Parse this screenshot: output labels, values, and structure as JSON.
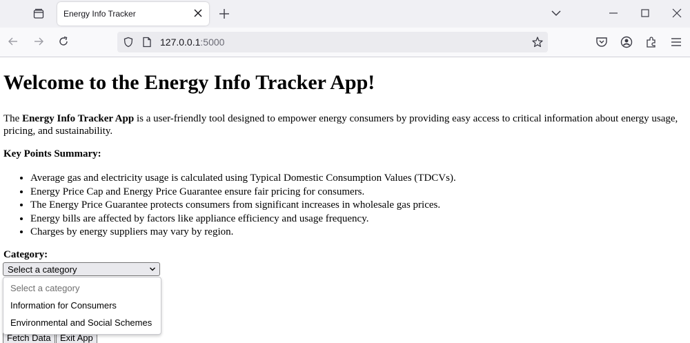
{
  "browser": {
    "tab_title": "Energy Info Tracker",
    "url_host": "127.0.0.1",
    "url_port": ":5000"
  },
  "page": {
    "heading": "Welcome to the Energy Info Tracker App!",
    "intro_prefix": "The ",
    "intro_bold": "Energy Info Tracker App",
    "intro_rest": " is a user-friendly tool designed to empower energy consumers by providing easy access to critical information about energy usage, pricing, and sustainability.",
    "key_points_title": "Key Points Summary:",
    "key_points": [
      "Average gas and electricity usage is calculated using Typical Domestic Consumption Values (TDCVs).",
      "Energy Price Cap and Energy Price Guarantee ensure fair pricing for consumers.",
      "The Energy Price Guarantee protects consumers from significant increases in wholesale gas prices.",
      "Energy bills are affected by factors like appliance efficiency and usage frequency.",
      "Charges by energy suppliers may vary by region."
    ],
    "category_label": "Category:",
    "category_selected": "Select a category",
    "category_options": [
      "Select a category",
      "Information for Consumers",
      "Environmental and Social Schemes"
    ],
    "fetch_button": "Fetch Data",
    "exit_button": "Exit App"
  }
}
